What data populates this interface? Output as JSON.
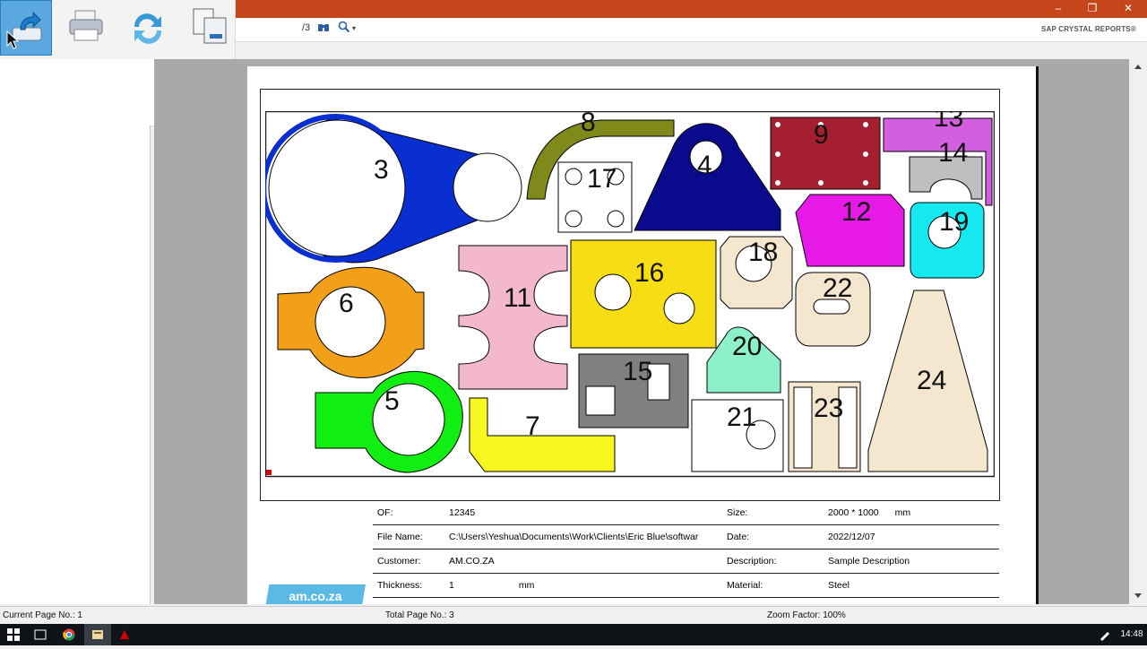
{
  "window": {
    "minimize": "–",
    "restore": "❐",
    "close": "✕"
  },
  "toolbar": {
    "page_total": "/3",
    "zoom_arrow": "▾",
    "brand": "SAP CRYSTAL REPORTS®"
  },
  "ribbon": {
    "buttons": [
      {
        "name": "export",
        "icon": "export-icon"
      },
      {
        "name": "print",
        "icon": "printer-icon"
      },
      {
        "name": "refresh",
        "icon": "refresh-icon"
      },
      {
        "name": "copy",
        "icon": "copy-pages-icon"
      }
    ]
  },
  "drawing": {
    "part_labels": [
      "3",
      "8",
      "17",
      "4",
      "9",
      "13",
      "14",
      "12",
      "19",
      "6",
      "11",
      "16",
      "18",
      "22",
      "20",
      "15",
      "5",
      "7",
      "21",
      "23",
      "24"
    ],
    "colors": {
      "blue": "#0a2fd0",
      "navy": "#0a0a8c",
      "olive": "#7f8a1a",
      "maroon": "#a41f30",
      "violet": "#d45ee0",
      "grey": "#bfbfbf",
      "magenta": "#e619e6",
      "cyan": "#16e8ef",
      "orange": "#f2a01a",
      "pink": "#f3b8cc",
      "yellow": "#f7de14",
      "cream": "#f4e6cf",
      "mint": "#8cf0c8",
      "slate": "#808080",
      "green": "#11ee11",
      "lemon": "#f8f820"
    }
  },
  "info": {
    "of_label": "OF:",
    "of_value": "12345",
    "size_label": "Size:",
    "size_value": "2000 * 1000",
    "size_unit": "mm",
    "file_label": "File Name:",
    "file_value": "C:\\Users\\Yeshua\\Documents\\Work\\Clients\\Eric Blue\\softwar",
    "date_label": "Date:",
    "date_value": "2022/12/07",
    "customer_label": "Customer:",
    "customer_value": "AM.CO.ZA",
    "desc_label": "Description:",
    "desc_value": "Sample Description",
    "thickness_label": "Thickness:",
    "thickness_value": "1",
    "thickness_unit": "mm",
    "material_label": "Material:",
    "material_value": "Steel"
  },
  "logo": "am.co.za",
  "status": {
    "current_page": "Current Page No.: 1",
    "total_page": "Total Page No.: 3",
    "zoom": "Zoom Factor: 100%"
  },
  "taskbar": {
    "time": "14:48"
  }
}
